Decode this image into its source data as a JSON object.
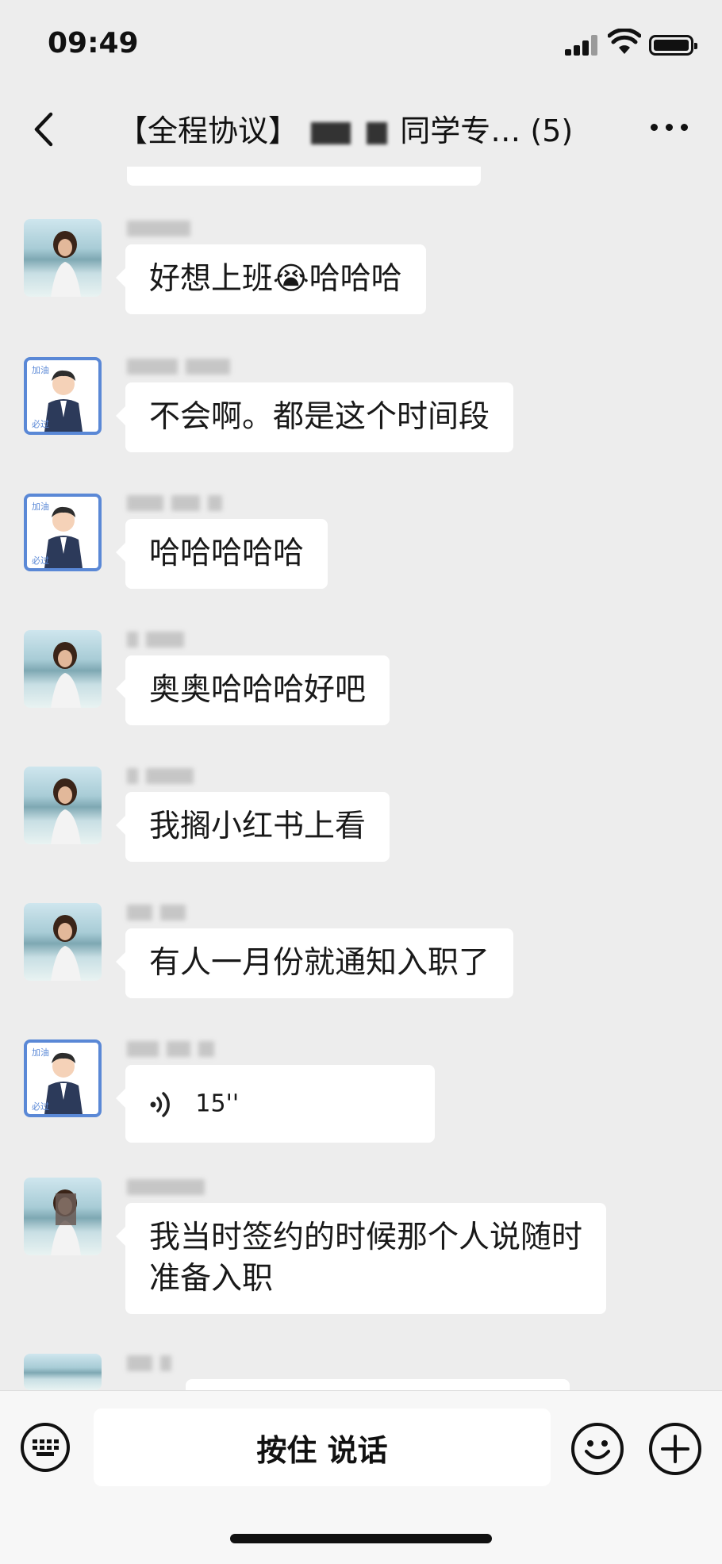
{
  "status": {
    "time": "09:49"
  },
  "header": {
    "title_prefix": "【全程协议】",
    "title_suffix": "同学专… (5)"
  },
  "messages": [
    {
      "text": "好想上班😭哈哈哈",
      "avatar": "sea"
    },
    {
      "text": "不会啊。都是这个时间段",
      "avatar": "cartoon"
    },
    {
      "text": "哈哈哈哈哈",
      "avatar": "cartoon"
    },
    {
      "text": "奥奥哈哈哈好吧",
      "avatar": "sea"
    },
    {
      "text": "我搁小红书上看",
      "avatar": "sea"
    },
    {
      "text": "有人一月份就通知入职了",
      "avatar": "sea"
    },
    {
      "text": "15''",
      "avatar": "cartoon",
      "type": "voice"
    },
    {
      "text": "我当时签约的时候那个人说随时准备入职",
      "avatar": "sea"
    }
  ],
  "input": {
    "hold_to_talk": "按住 说话"
  }
}
